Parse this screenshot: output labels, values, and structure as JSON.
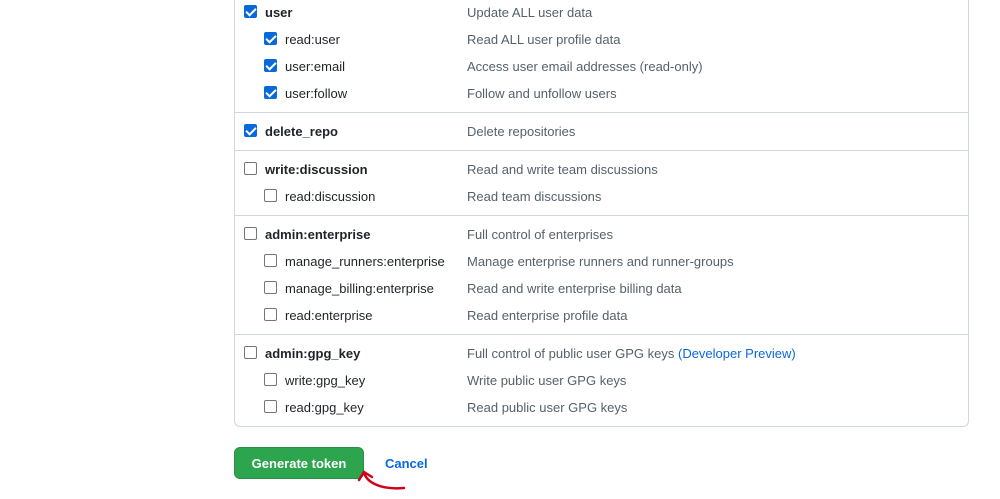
{
  "scope_groups": [
    {
      "parent": {
        "name": "user",
        "description": "Update ALL user data",
        "checked": true
      },
      "children": [
        {
          "name": "read:user",
          "description": "Read ALL user profile data",
          "checked": true
        },
        {
          "name": "user:email",
          "description": "Access user email addresses (read-only)",
          "checked": true
        },
        {
          "name": "user:follow",
          "description": "Follow and unfollow users",
          "checked": true
        }
      ]
    },
    {
      "parent": {
        "name": "delete_repo",
        "description": "Delete repositories",
        "checked": true
      },
      "children": []
    },
    {
      "parent": {
        "name": "write:discussion",
        "description": "Read and write team discussions",
        "checked": false
      },
      "children": [
        {
          "name": "read:discussion",
          "description": "Read team discussions",
          "checked": false
        }
      ]
    },
    {
      "parent": {
        "name": "admin:enterprise",
        "description": "Full control of enterprises",
        "checked": false
      },
      "children": [
        {
          "name": "manage_runners:enterprise",
          "description": "Manage enterprise runners and runner-groups",
          "checked": false
        },
        {
          "name": "manage_billing:enterprise",
          "description": "Read and write enterprise billing data",
          "checked": false
        },
        {
          "name": "read:enterprise",
          "description": "Read enterprise profile data",
          "checked": false
        }
      ]
    },
    {
      "parent": {
        "name": "admin:gpg_key",
        "description": "Full control of public user GPG keys",
        "description_link": "(Developer Preview)",
        "checked": false
      },
      "children": [
        {
          "name": "write:gpg_key",
          "description": "Write public user GPG keys",
          "checked": false
        },
        {
          "name": "read:gpg_key",
          "description": "Read public user GPG keys",
          "checked": false
        }
      ]
    }
  ],
  "actions": {
    "generate_label": "Generate token",
    "cancel_label": "Cancel"
  },
  "colors": {
    "primary_button": "#2da44e",
    "link": "#0969da",
    "annotation": "#d0021b"
  },
  "icons": {
    "annotation": "red-curved-arrow-icon"
  }
}
